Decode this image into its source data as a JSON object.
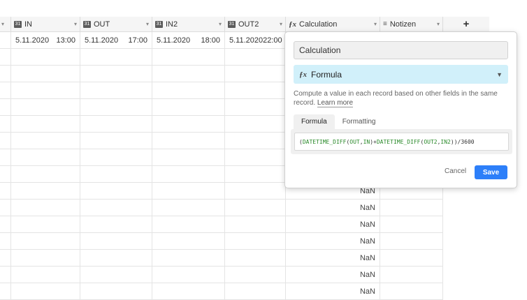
{
  "columns": [
    {
      "label": "",
      "icon": "expand-caret"
    },
    {
      "label": "IN",
      "icon": "calendar-icon"
    },
    {
      "label": "OUT",
      "icon": "calendar-icon"
    },
    {
      "label": "IN2",
      "icon": "calendar-icon"
    },
    {
      "label": "OUT2",
      "icon": "calendar-icon"
    },
    {
      "label": "Calculation",
      "icon": "formula-icon"
    },
    {
      "label": "Notizen",
      "icon": "long-text-icon"
    }
  ],
  "add_column_label": "+",
  "first_row": {
    "in_date": "5.11.2020",
    "in_time": "13:00",
    "out_date": "5.11.2020",
    "out_time": "17:00",
    "in2_date": "5.11.2020",
    "in2_time": "18:00",
    "out2_date": "5.11.2020",
    "out2_time": "22:00"
  },
  "nan_value": "NaN",
  "popup": {
    "field_name": "Calculation",
    "field_type": "Formula",
    "description": "Compute a value in each record based on other fields in the same record.",
    "learn_more": "Learn more",
    "tabs": [
      "Formula",
      "Formatting"
    ],
    "formula_parts": [
      "(",
      "DATETIME_DIFF",
      "(",
      "OUT",
      ",",
      "IN",
      ")",
      "+",
      "DATETIME_DIFF",
      "(",
      "OUT2",
      ",",
      "IN2",
      ")",
      ")",
      "/3600"
    ],
    "cancel_label": "Cancel",
    "save_label": "Save"
  },
  "colors": {
    "accent": "#2d7ff9",
    "type_bg": "#d1f0fa",
    "formula_green": "#2a8a2a"
  }
}
